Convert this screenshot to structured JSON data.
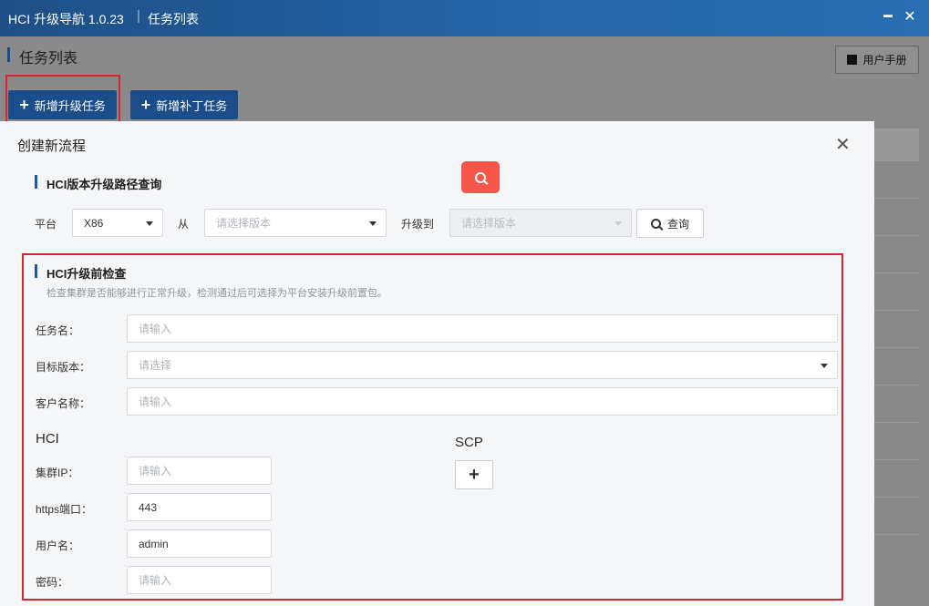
{
  "titlebar": {
    "app_name": "HCI 升级导航 1.0.23",
    "separator": "|",
    "page_name": "任务列表",
    "minimize_glyph": "━",
    "close_glyph": "✕"
  },
  "page": {
    "heading": "任务列表",
    "manual_button": "用户手册",
    "manual_icon": "book-icon",
    "add_upgrade_task": "新增升级任务",
    "add_patch_task": "新增补丁任务",
    "plus_glyph": "+"
  },
  "modal": {
    "title": "创建新流程",
    "close_glyph": "✕",
    "path_query": {
      "title": "HCI版本升级路径查询",
      "platform_label": "平台",
      "platform_value": "X86",
      "from_label": "从",
      "from_placeholder": "请选择版本",
      "to_label": "升级到",
      "to_placeholder": "请选择版本",
      "query_button": "查询",
      "search_icon": "search-icon"
    },
    "precheck": {
      "title": "HCI升级前检查",
      "description": "检查集群是否能够进行正常升级，检测通过后可选择为平台安装升级前置包。",
      "task_name_label": "任务名：",
      "task_name_placeholder": "请输入",
      "target_version_label": "目标版本：",
      "target_version_placeholder": "请选择",
      "customer_name_label": "客户名称：",
      "customer_name_placeholder": "请输入",
      "hci_heading": "HCI",
      "scp_heading": "SCP",
      "scp_add_glyph": "+",
      "cluster_ip_label": "集群IP：",
      "cluster_ip_placeholder": "请输入",
      "https_port_label": "https端口：",
      "https_port_value": "443",
      "username_label": "用户名：",
      "username_value": "admin",
      "password_label": "密码：",
      "password_placeholder": "请输入"
    }
  },
  "colors": {
    "primary": "#1a4d89",
    "accent_red": "#f5564a",
    "highlight": "#d9252d"
  }
}
